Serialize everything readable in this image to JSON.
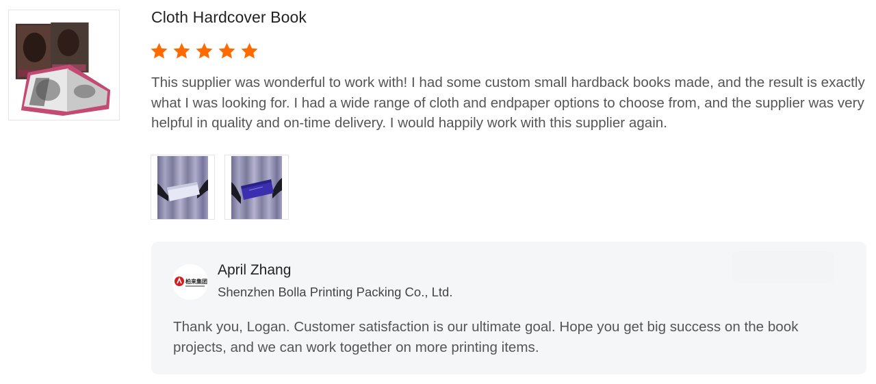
{
  "product": {
    "title": "Cloth Hardcover Book",
    "thumbnail_icon": "book-photo-thumbnail"
  },
  "review": {
    "rating": 5,
    "rating_max": 5,
    "star_color": "#ff6a00",
    "text": "This supplier was wonderful to work with! I had some custom small hardback books made, and the result is exactly what I was looking for. I had a wide range of cloth and endpaper options to choose from, and the supplier was very helpful in quality and on-time delivery. I would happily work with this supplier again.",
    "photos": [
      {
        "icon": "white-book-photo-icon"
      },
      {
        "icon": "blue-book-photo-icon"
      }
    ]
  },
  "reply": {
    "name": "April Zhang",
    "company": "Shenzhen Bolla Printing Packing Co., Ltd.",
    "logo_text": "柏来集团",
    "text": "Thank you, Logan. Customer satisfaction is our ultimate goal. Hope you get big success on the book projects, and we can work together on more printing items.",
    "background": "#f5f6f8"
  }
}
